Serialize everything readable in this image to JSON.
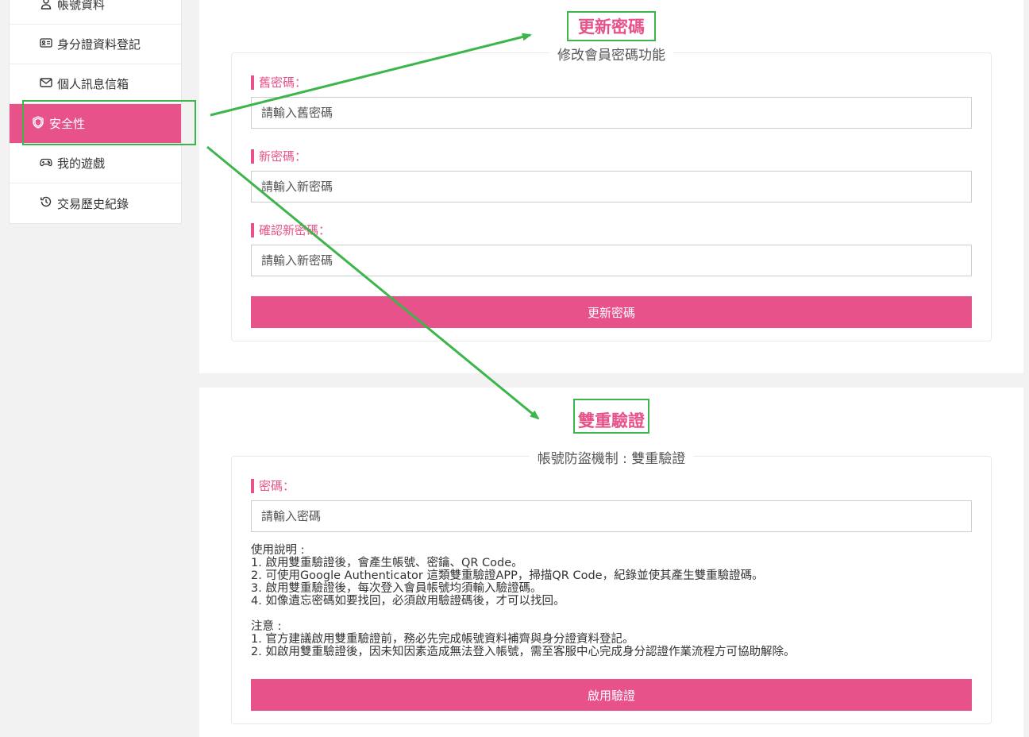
{
  "sidebar": {
    "items": [
      {
        "label": "帳號資料",
        "icon": "user-icon"
      },
      {
        "label": "身分證資料登記",
        "icon": "id-card-icon"
      },
      {
        "label": "個人訊息信箱",
        "icon": "mail-icon"
      },
      {
        "label": "安全性",
        "icon": "shield-icon",
        "active": true
      },
      {
        "label": "我的遊戲",
        "icon": "gamepad-icon"
      },
      {
        "label": "交易歷史紀錄",
        "icon": "history-icon"
      }
    ]
  },
  "password_section": {
    "title": "更新密碼",
    "legend": "修改會員密碼功能",
    "old_label": "舊密碼：",
    "old_placeholder": "請輸入舊密碼",
    "new_label": "新密碼：",
    "new_placeholder": "請輸入新密碼",
    "confirm_label": "確認新密碼：",
    "confirm_placeholder": "請輸入新密碼",
    "submit_label": "更新密碼"
  },
  "twofa_section": {
    "title": "雙重驗證",
    "legend": "帳號防盜機制 : 雙重驗證",
    "password_label": "密碼：",
    "password_placeholder": "請輸入密碼",
    "usage_heading": "使用說明 :",
    "usage": [
      "1. 啟用雙重驗證後，會產生帳號、密鑰、QR Code。",
      "2. 可使用Google Authenticator 這類雙重驗證APP，掃描QR Code，紀錄並使其產生雙重驗證碼。",
      "3. 啟用雙重驗證後，每次登入會員帳號均須輸入驗證碼。",
      "4. 如像遺忘密碼如要找回，必須啟用驗證碼後，才可以找回。"
    ],
    "notice_heading": "注意 :",
    "notice": [
      "1. 官方建議啟用雙重驗證前，務必先完成帳號資料補齊與身分證資料登記。",
      "2. 如啟用雙重驗證後，因未知因素造成無法登入帳號，需至客服中心完成身分認證作業流程方可協助解除。"
    ],
    "submit_label": "啟用驗證"
  },
  "colors": {
    "accent": "#e8528a",
    "annotation": "#3cb64a"
  }
}
